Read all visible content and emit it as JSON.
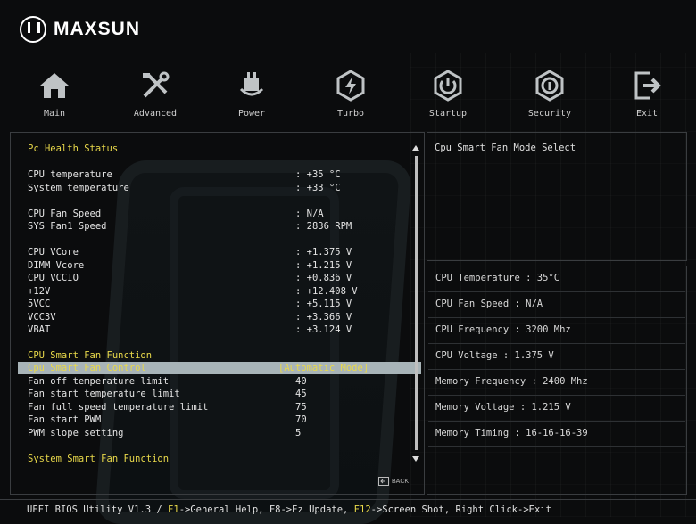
{
  "brand": {
    "name": "MAXSUN"
  },
  "nav": [
    {
      "label": "Main",
      "icon": "home-icon"
    },
    {
      "label": "Advanced",
      "icon": "tools-icon"
    },
    {
      "label": "Power",
      "icon": "power-plug-icon"
    },
    {
      "label": "Turbo",
      "icon": "turbo-bolt-icon"
    },
    {
      "label": "Startup",
      "icon": "startup-power-icon"
    },
    {
      "label": "Security",
      "icon": "security-shield-icon"
    },
    {
      "label": "Exit",
      "icon": "exit-icon"
    }
  ],
  "health": {
    "title": "Pc Health Status",
    "rows": [
      {
        "label": "CPU temperature",
        "value": ": +35 °C"
      },
      {
        "label": "System temperature",
        "value": ": +33 °C"
      },
      {
        "label": "CPU Fan Speed",
        "value": ": N/A"
      },
      {
        "label": "SYS Fan1 Speed",
        "value": ": 2836 RPM"
      },
      {
        "label": "CPU VCore",
        "value": ": +1.375 V"
      },
      {
        "label": "DIMM Vcore",
        "value": ": +1.215 V"
      },
      {
        "label": "CPU VCCIO",
        "value": ": +0.836 V"
      },
      {
        "label": "+12V",
        "value": ": +12.408 V"
      },
      {
        "label": "5VCC",
        "value": ": +5.115 V"
      },
      {
        "label": "VCC3V",
        "value": ": +3.366 V"
      },
      {
        "label": "VBAT",
        "value": ": +3.124 V"
      }
    ]
  },
  "cpu_fan": {
    "title": "CPU Smart Fan Function",
    "control_label": "Cpu Smart Fan Control",
    "control_value": "[Automatic Mode]",
    "rows": [
      {
        "label": "Fan off temperature limit",
        "value": "40"
      },
      {
        "label": "Fan start temperature limit",
        "value": "45"
      },
      {
        "label": "Fan full speed temperature limit",
        "value": "75"
      },
      {
        "label": "Fan start PWM",
        "value": "70"
      },
      {
        "label": "PWM slope setting",
        "value": "5"
      }
    ]
  },
  "sys_fan": {
    "title": "System Smart Fan Function"
  },
  "help": {
    "text": "Cpu Smart Fan Mode Select"
  },
  "info": [
    {
      "text": "CPU Temperature : 35°C"
    },
    {
      "text": "CPU Fan Speed : N/A"
    },
    {
      "text": "CPU Frequency : 3200 Mhz"
    },
    {
      "text": "CPU Voltage : 1.375 V"
    },
    {
      "text": "Memory Frequency : 2400 Mhz"
    },
    {
      "text": "Memory Voltage : 1.215 V"
    },
    {
      "text": "Memory Timing : 16-16-16-39"
    }
  ],
  "back": {
    "label": "BACK"
  },
  "status": {
    "prefix": "UEFI BIOS Utility V1.3 / ",
    "k1": "F1",
    "t1": "->General Help, F8->Ez Update, ",
    "k2": "F12",
    "t2": "->Screen Shot, Right Click->Exit"
  },
  "colors": {
    "accent": "#e8d84a",
    "selected_bg": "#a8b4b8",
    "border": "#3a3d40"
  }
}
